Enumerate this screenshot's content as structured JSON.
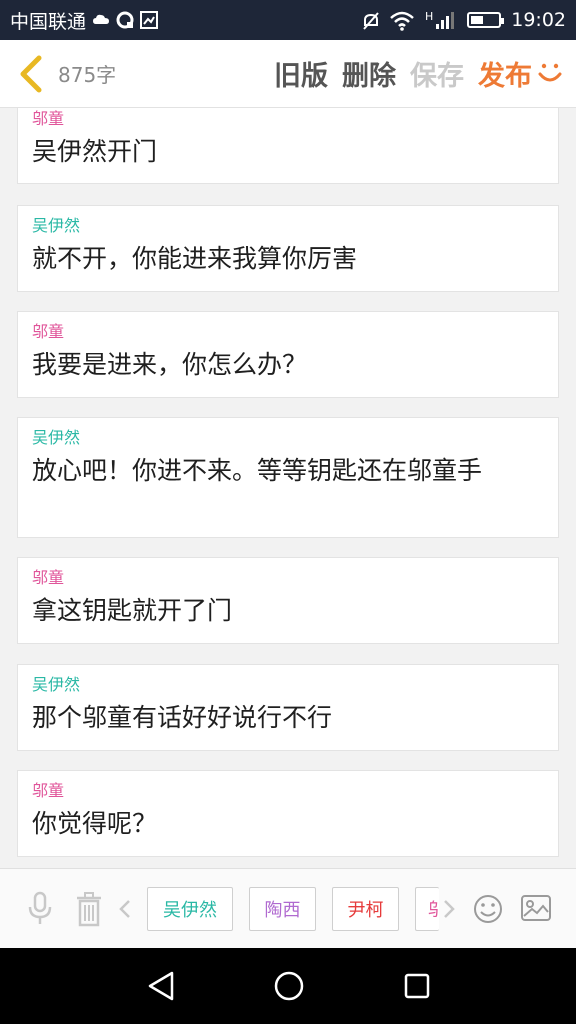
{
  "status_bar": {
    "carrier": "中国联通",
    "network_label": "H",
    "battery_level": 0.45,
    "time": "19:02"
  },
  "header": {
    "word_count": "875字",
    "old_version": "旧版",
    "delete": "删除",
    "save": "保存",
    "publish": "发布"
  },
  "colors": {
    "pink": "#e0559a",
    "teal": "#2ab8a5",
    "purple": "#b06ad0",
    "red": "#e63b3b",
    "orange": "#ee7a35"
  },
  "messages": [
    {
      "speaker": "邬童",
      "text": "吴伊然开门"
    },
    {
      "speaker": "吴伊然",
      "text": "就不开，你能进来我算你厉害"
    },
    {
      "speaker": "邬童",
      "text": "我要是进来，你怎么办？"
    },
    {
      "speaker": "吴伊然",
      "text": "放心吧！你进不来。等等钥匙还在邬童手"
    },
    {
      "speaker": "邬童",
      "text": "拿这钥匙就开了门"
    },
    {
      "speaker": "吴伊然",
      "text": "那个邬童有话好好说行不行"
    },
    {
      "speaker": "邬童",
      "text": "你觉得呢？"
    }
  ],
  "toolbar": {
    "characters": [
      "吴伊然",
      "陶西",
      "尹柯",
      "邬"
    ],
    "icons": [
      "microphone-icon",
      "trash-icon",
      "chevron-left-icon",
      "chevron-right-icon",
      "smiley-icon",
      "image-icon"
    ]
  },
  "nav": {
    "icons": [
      "back-triangle-icon",
      "home-circle-icon",
      "recents-square-icon"
    ]
  }
}
